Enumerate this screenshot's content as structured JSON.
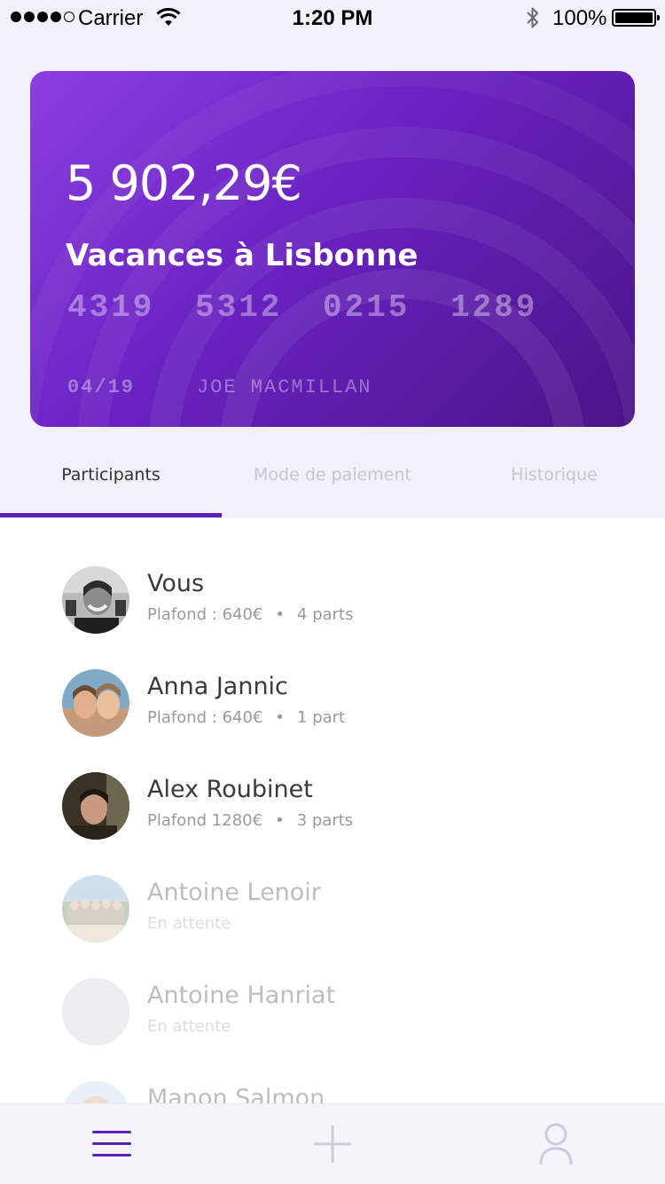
{
  "status_bar": {
    "carrier": "Carrier",
    "time": "1:20 PM",
    "battery": "100%"
  },
  "card": {
    "balance": "5 902,29€",
    "name": "Vacances à Lisbonne",
    "number_groups": [
      "4319",
      "5312",
      "0215",
      "1289"
    ],
    "expiry": "04/19",
    "holder": "JOE MACMILLAN",
    "gradient_colors": [
      "#8c3fe0",
      "#6a22c2",
      "#4b1487"
    ]
  },
  "tabs": [
    {
      "label": "Participants",
      "active": true
    },
    {
      "label": "Mode de paiement",
      "active": false
    },
    {
      "label": "Historique",
      "active": false
    }
  ],
  "participants": [
    {
      "name": "Vous",
      "limit": "Plafond : 640€",
      "parts": "4 parts",
      "status": "active"
    },
    {
      "name": "Anna Jannic",
      "limit": "Plafond : 640€",
      "parts": "1 part",
      "status": "active"
    },
    {
      "name": "Alex Roubinet",
      "limit": "Plafond 1280€",
      "parts": "3 parts",
      "status": "active"
    },
    {
      "name": "Antoine Lenoir",
      "limit": "En attente",
      "parts": "",
      "status": "pending"
    },
    {
      "name": "Antoine Hanriat",
      "limit": "En attente",
      "parts": "",
      "status": "pending"
    },
    {
      "name": "Manon Salmon",
      "limit": "",
      "parts": "",
      "status": "pending"
    }
  ],
  "meta_separator": "•",
  "bottom_nav": {
    "icons": [
      "menu-icon",
      "plus-icon",
      "user-icon"
    ],
    "accent": "#5a22b8"
  }
}
